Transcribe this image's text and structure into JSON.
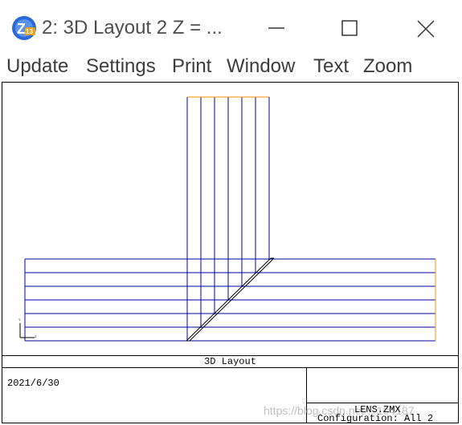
{
  "window": {
    "title": "2: 3D Layout 2 Z = ...",
    "icon": "zemax-z13-icon",
    "controls": [
      "minimize-icon",
      "maximize-icon",
      "close-icon"
    ]
  },
  "menu": {
    "update": "Update",
    "settings": "Settings",
    "print": "Print",
    "window": "Window",
    "text": "Text",
    "zoom": "Zoom"
  },
  "plot": {
    "caption": "3D Layout",
    "date": "2021/6/30",
    "file": "LENS.ZMX",
    "configuration": "Configuration: All 2",
    "axis_y": "Y",
    "axis_z": "Z",
    "watermark": "https://blog.csdn.net/...104187",
    "colors": {
      "rays": "#0000a0",
      "source": "#ff8c00",
      "frame": "#000000"
    }
  }
}
